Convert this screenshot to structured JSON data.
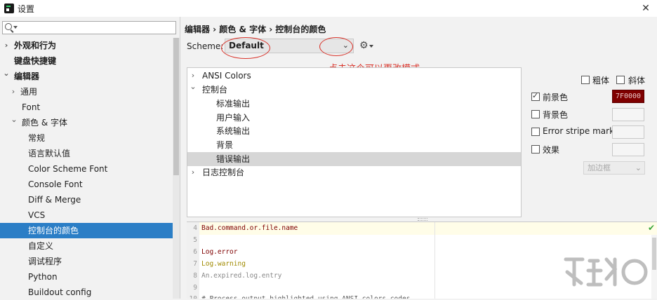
{
  "window": {
    "title": "设置",
    "close_glyph": "✕"
  },
  "search": {
    "placeholder": "",
    "icon": "search-icon"
  },
  "sidebar": {
    "items": [
      {
        "label": "外观和行为",
        "arrow": "›",
        "bold": true
      },
      {
        "label": "键盘快捷键",
        "arrow": "",
        "bold": true
      },
      {
        "label": "编辑器",
        "arrow": "⌄",
        "bold": true
      },
      {
        "label": "通用",
        "arrow": "›",
        "bold": false
      },
      {
        "label": "Font",
        "arrow": "",
        "bold": false
      },
      {
        "label": "颜色 & 字体",
        "arrow": "⌄",
        "bold": false
      },
      {
        "label": "常规",
        "arrow": "",
        "bold": false
      },
      {
        "label": "语言默认值",
        "arrow": "",
        "bold": false
      },
      {
        "label": "Color Scheme Font",
        "arrow": "",
        "bold": false
      },
      {
        "label": "Console Font",
        "arrow": "",
        "bold": false
      },
      {
        "label": "Diff & Merge",
        "arrow": "",
        "bold": false
      },
      {
        "label": "VCS",
        "arrow": "",
        "bold": false
      },
      {
        "label": "控制台的颜色",
        "arrow": "",
        "bold": false,
        "selected": true
      },
      {
        "label": "自定义",
        "arrow": "",
        "bold": false
      },
      {
        "label": "调试程序",
        "arrow": "",
        "bold": false
      },
      {
        "label": "Python",
        "arrow": "",
        "bold": false
      },
      {
        "label": "Buildout config",
        "arrow": "",
        "bold": false
      }
    ]
  },
  "breadcrumb": "编辑器 › 颜色 & 字体 › 控制台的颜色",
  "scheme": {
    "label": "Scheme:",
    "value": "Default",
    "chevron": "⌄",
    "gear": "⚙"
  },
  "annotation": "点击这个可以更改模式",
  "attributes_tree": {
    "items": [
      {
        "label": "ANSI Colors",
        "arrow": "›"
      },
      {
        "label": "控制台",
        "arrow": "⌄"
      },
      {
        "label": "标准输出",
        "arrow": ""
      },
      {
        "label": "用户输入",
        "arrow": ""
      },
      {
        "label": "系统输出",
        "arrow": ""
      },
      {
        "label": "背景",
        "arrow": ""
      },
      {
        "label": "错误输出",
        "arrow": "",
        "selected": true
      },
      {
        "label": "日志控制台",
        "arrow": "›"
      }
    ]
  },
  "options": {
    "bold_label": "粗体",
    "italic_label": "斜体",
    "foreground_label": "前景色",
    "foreground_checked": true,
    "foreground_value": "7F0000",
    "foreground_color": "#7f0000",
    "background_label": "背景色",
    "error_stripe_label": "Error stripe mark",
    "effects_label": "效果",
    "effect_type": "加边框",
    "effect_chevron": "⌄"
  },
  "preview": {
    "status_glyph": "✔",
    "lines": [
      {
        "num": "4",
        "text": "Bad.command.or.file.name",
        "color": "#7f0000"
      },
      {
        "num": "5",
        "text": "",
        "color": "#000000"
      },
      {
        "num": "6",
        "text": "Log.error",
        "color": "#7f0000"
      },
      {
        "num": "7",
        "text": "Log.warning",
        "color": "#a08a00"
      },
      {
        "num": "8",
        "text": "An.expired.log.entry",
        "color": "#888888"
      },
      {
        "num": "9",
        "text": "",
        "color": "#000000"
      },
      {
        "num": "10",
        "text": "# Process output highlighted using ANSI colors codes",
        "color": "#555555"
      }
    ]
  }
}
